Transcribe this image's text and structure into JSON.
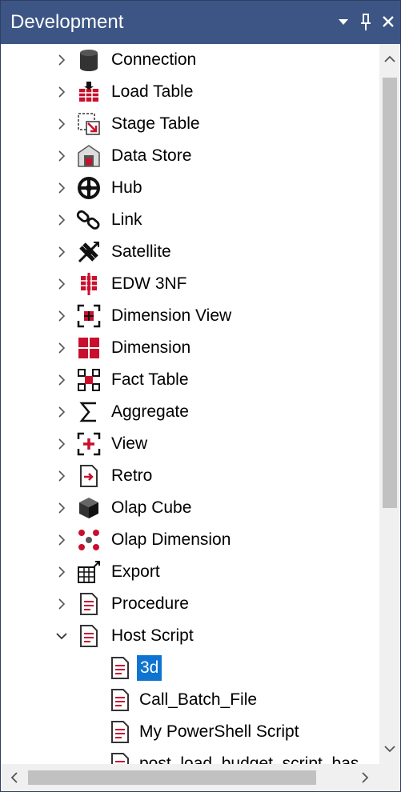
{
  "panel": {
    "title": "Development",
    "controls": {
      "dropdown": "chevron-down-icon",
      "pin": "pin-icon",
      "close": "close-icon"
    }
  },
  "tree": {
    "items": [
      {
        "label": "Connection",
        "icon": "cylinder-icon",
        "expanded": false
      },
      {
        "label": "Load Table",
        "icon": "load-table-icon",
        "expanded": false
      },
      {
        "label": "Stage Table",
        "icon": "stage-table-icon",
        "expanded": false
      },
      {
        "label": "Data Store",
        "icon": "data-store-icon",
        "expanded": false
      },
      {
        "label": "Hub",
        "icon": "hub-icon",
        "expanded": false
      },
      {
        "label": "Link",
        "icon": "link-icon",
        "expanded": false
      },
      {
        "label": "Satellite",
        "icon": "satellite-icon",
        "expanded": false
      },
      {
        "label": "EDW 3NF",
        "icon": "edw-3nf-icon",
        "expanded": false
      },
      {
        "label": "Dimension View",
        "icon": "dimension-view-icon",
        "expanded": false
      },
      {
        "label": "Dimension",
        "icon": "dimension-icon",
        "expanded": false
      },
      {
        "label": "Fact Table",
        "icon": "fact-table-icon",
        "expanded": false
      },
      {
        "label": "Aggregate",
        "icon": "sigma-icon",
        "expanded": false
      },
      {
        "label": "View",
        "icon": "view-icon",
        "expanded": false
      },
      {
        "label": "Retro",
        "icon": "retro-icon",
        "expanded": false
      },
      {
        "label": "Olap Cube",
        "icon": "cube-icon",
        "expanded": false
      },
      {
        "label": "Olap Dimension",
        "icon": "olap-dimension-icon",
        "expanded": false
      },
      {
        "label": "Export",
        "icon": "export-icon",
        "expanded": false
      },
      {
        "label": "Procedure",
        "icon": "document-icon",
        "expanded": false
      },
      {
        "label": "Host Script",
        "icon": "document-icon",
        "expanded": true
      }
    ],
    "children": [
      {
        "label": "3d",
        "selected": true
      },
      {
        "label": "Call_Batch_File",
        "selected": false
      },
      {
        "label": "My PowerShell Script",
        "selected": false
      },
      {
        "label": "post_load_budget_script_bas",
        "selected": false
      }
    ]
  },
  "colors": {
    "titlebar": "#3c5585",
    "selection": "#0f74d1",
    "icon_red": "#c8102e"
  }
}
